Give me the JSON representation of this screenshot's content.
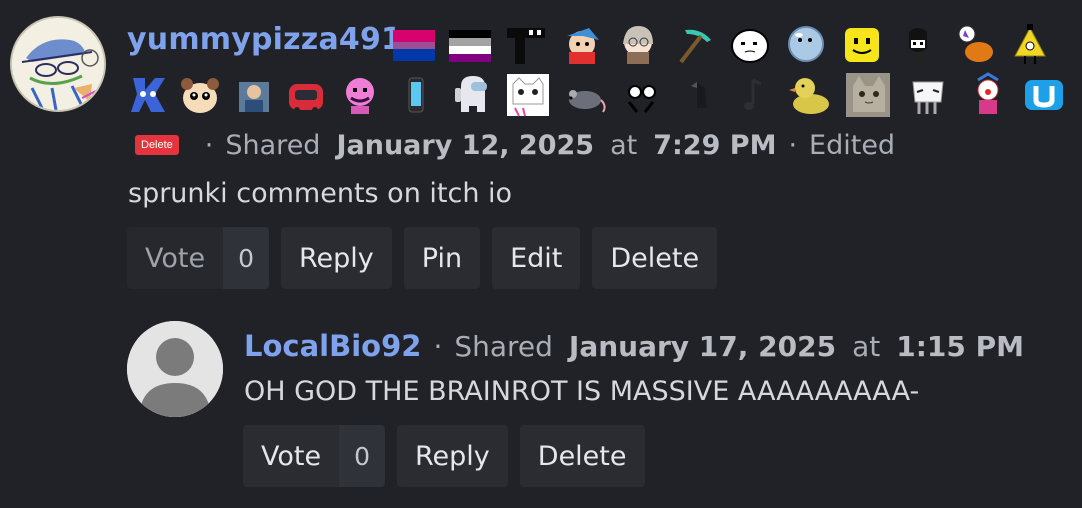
{
  "comment": {
    "username": "yummypizza491",
    "delete_badge": "Delete",
    "shared_prefix": "Shared",
    "date": "January 12, 2025",
    "at": "at",
    "time": "7:29 PM",
    "edited": "Edited",
    "text": "sprunki comments on itch io",
    "vote_label": "Vote",
    "vote_count": "0",
    "actions": {
      "reply": "Reply",
      "pin": "Pin",
      "edit": "Edit",
      "delete": "Delete"
    },
    "badge_icons": [
      "bisexual-flag-icon",
      "asexual-flag-icon",
      "black-creature-icon",
      "fnf-boyfriend-icon",
      "old-man-icon",
      "pickaxe-icon",
      "blob-face-icon",
      "bubble-icon",
      "roblox-face-icon",
      "incredibox-icon",
      "pumpkin-icon",
      "bill-cipher-icon",
      "four-character-icon",
      "hamster-icon",
      "person-photo-icon",
      "red-car-icon",
      "pink-face-icon",
      "phone-icon",
      "among-us-icon",
      "cat-drawing-icon",
      "rat-icon",
      "dots-icon",
      "black-bird-icon",
      "music-note-icon",
      "rubber-duck-icon",
      "cat-photo-icon",
      "white-creature-icon",
      "clown-icon",
      "wii-u-icon"
    ]
  },
  "reply": {
    "username": "LocalBio92",
    "shared_prefix": "Shared",
    "date": "January 17, 2025",
    "at": "at",
    "time": "1:15 PM",
    "text": "OH GOD THE BRAINROT IS MASSIVE AAAAAAAAA-",
    "vote_label": "Vote",
    "vote_count": "0",
    "actions": {
      "reply": "Reply",
      "delete": "Delete"
    }
  },
  "colors": {
    "background": "#202227",
    "username": "#7fa2ec",
    "delete_badge": "#e4343d"
  }
}
